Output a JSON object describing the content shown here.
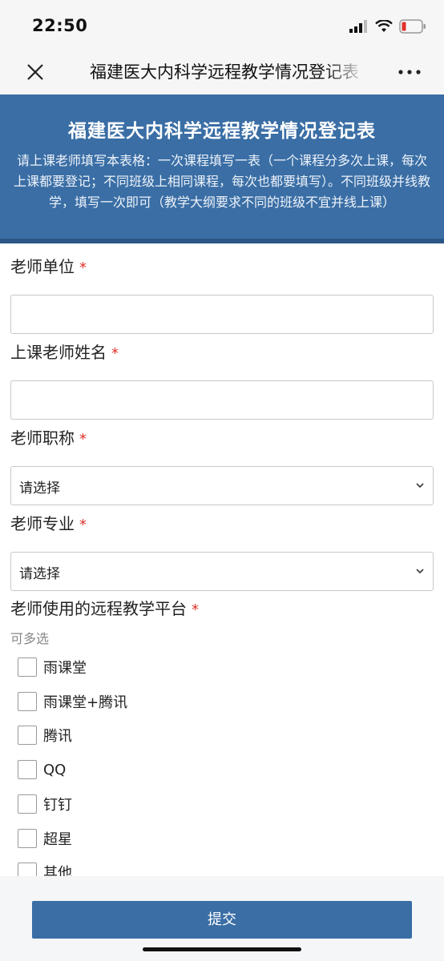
{
  "status_bar": {
    "time": "22:50"
  },
  "navbar": {
    "title": "福建医大内科学远程教学情况登记表"
  },
  "banner": {
    "title": "福建医大内科学远程教学情况登记表",
    "description": "请上课老师填写本表格：一次课程填写一表（一个课程分多次上课，每次上课都要登记；不同班级上相同课程，每次也都要填写）。不同班级并线教学，填写一次即可（教学大纲要求不同的班级不宜并线上课）"
  },
  "form": {
    "required_mark": "*",
    "unit": {
      "label": "老师单位",
      "value": ""
    },
    "name": {
      "label": "上课老师姓名",
      "value": ""
    },
    "title_select": {
      "label": "老师职称",
      "value": "请选择"
    },
    "major_select": {
      "label": "老师专业",
      "value": "请选择"
    },
    "platform": {
      "label": "老师使用的远程教学平台",
      "hint": "可多选",
      "options": [
        "雨课堂",
        "雨课堂+腾讯",
        "腾讯",
        "QQ",
        "钉钉",
        "超星",
        "其他"
      ]
    }
  },
  "submit": {
    "label": "提交"
  },
  "colors": {
    "accent": "#3a6ea5",
    "required": "#e0302a"
  },
  "icons": [
    "signal-icon",
    "wifi-icon",
    "battery-icon",
    "close-icon",
    "more-icon",
    "chevron-down-icon"
  ]
}
